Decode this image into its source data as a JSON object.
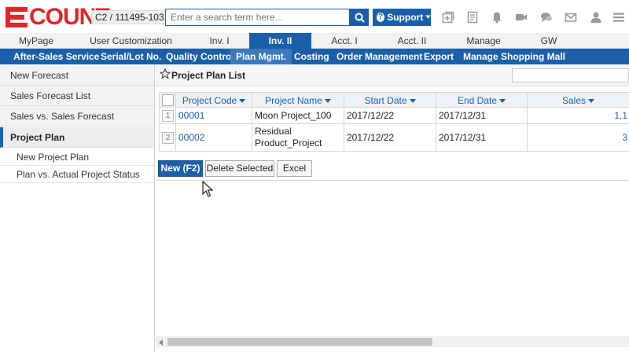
{
  "header": {
    "logo_text": "COUNT",
    "company_code": "C2 / 111495-103",
    "search_placeholder": "Enter a search term here...",
    "support_label": "Support",
    "icons": [
      "add-window-icon",
      "document-icon",
      "bell-icon",
      "video-icon",
      "chat-icon",
      "mail-icon",
      "user-icon",
      "menu-icon"
    ],
    "brand_color": "#e0262b",
    "accent_color": "#1b5fa8"
  },
  "main_tabs": [
    {
      "label": "MyPage",
      "active": false
    },
    {
      "label": "User Customization",
      "active": false
    },
    {
      "label": "Inv. I",
      "active": false
    },
    {
      "label": "Inv. II",
      "active": true
    },
    {
      "label": "Acct. I",
      "active": false
    },
    {
      "label": "Acct. II",
      "active": false
    },
    {
      "label": "Manage",
      "active": false
    },
    {
      "label": "GW",
      "active": false
    }
  ],
  "sub_menu": [
    {
      "label": "After-Sales Service",
      "active": false
    },
    {
      "label": "Serial/Lot No.",
      "active": false
    },
    {
      "label": "Quality Control",
      "active": false
    },
    {
      "label": "Plan Mgmt.",
      "active": true
    },
    {
      "label": "Costing",
      "active": false
    },
    {
      "label": "Order Management",
      "active": false
    },
    {
      "label": "Export",
      "active": false
    },
    {
      "label": "Manage Shopping Mall",
      "active": false
    }
  ],
  "sidebar": {
    "items": [
      {
        "label": "New Forecast"
      },
      {
        "label": "Sales Forecast List"
      },
      {
        "label": "Sales vs. Sales Forecast"
      },
      {
        "label": "Project Plan"
      }
    ],
    "sub_items": [
      {
        "label": "New Project Plan"
      },
      {
        "label": "Plan vs. Actual Project Status"
      }
    ]
  },
  "content": {
    "title": "Project Plan List",
    "columns": [
      "Project Code",
      "Project Name",
      "Start Date",
      "End Date",
      "Sales"
    ],
    "rows": [
      {
        "num": "1",
        "code": "00001",
        "name": "Moon Project_100",
        "start": "2017/12/22",
        "end": "2017/12/31",
        "sales": "1,1"
      },
      {
        "num": "2",
        "code": "00002",
        "name_line1": "Residual",
        "name_line2": "Product_Project",
        "start": "2017/12/22",
        "end": "2017/12/31",
        "sales": "3"
      }
    ],
    "buttons": {
      "new": "New (F2)",
      "delete": "Delete Selected",
      "excel": "Excel"
    }
  }
}
